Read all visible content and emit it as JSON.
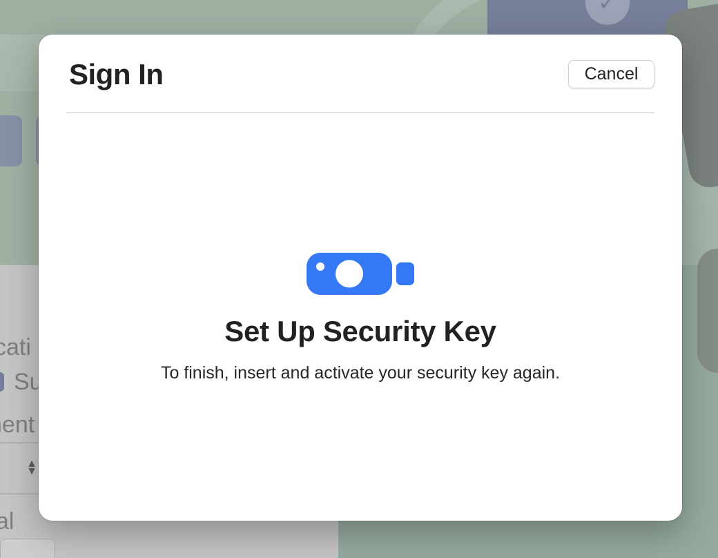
{
  "background_window": {
    "fragment_top": "cati",
    "fragment_toggle_label": "Su",
    "fragment_middle": "nent",
    "fragment_bottom": "al",
    "stepper_glyph": "▲▼"
  },
  "dialog": {
    "title": "Sign In",
    "cancel_label": "Cancel",
    "icon": "security-key-icon",
    "heading": "Set Up Security Key",
    "message": "To finish, insert and activate your security key again."
  },
  "colors": {
    "accent": "#3478f6",
    "dialog_background": "#ffffff",
    "text_primary": "#222222"
  }
}
